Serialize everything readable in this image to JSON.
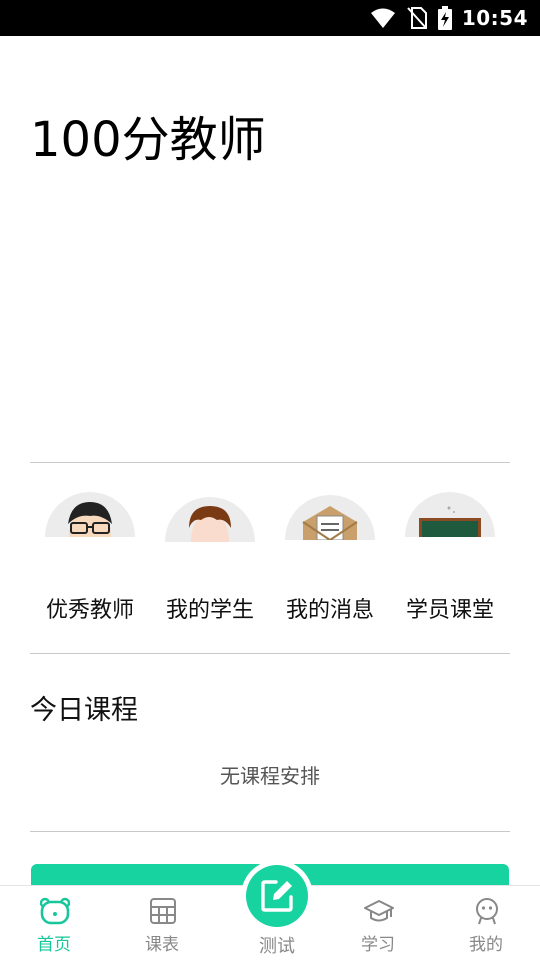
{
  "status_bar": {
    "time": "10:54",
    "icons": [
      "wifi-icon",
      "no-sim-icon",
      "battery-charging-icon"
    ]
  },
  "header": {
    "title": "100分教师"
  },
  "quick_menu": {
    "items": [
      {
        "label": "优秀教师",
        "icon": "teacher-avatar-icon"
      },
      {
        "label": "我的学生",
        "icon": "student-avatar-icon"
      },
      {
        "label": "我的消息",
        "icon": "message-envelope-icon"
      },
      {
        "label": "学员课堂",
        "icon": "classroom-blackboard-icon"
      }
    ]
  },
  "today_courses": {
    "title": "今日课程",
    "empty_text": "无课程安排"
  },
  "tab_bar": {
    "active_color": "#17c69a",
    "inactive_color": "#888888",
    "tabs": [
      {
        "label": "首页",
        "icon": "home-bear-icon",
        "active": true
      },
      {
        "label": "课表",
        "icon": "timetable-grid-icon",
        "active": false
      },
      {
        "label": "测试",
        "icon": "edit-pencil-icon",
        "active": false
      },
      {
        "label": "学习",
        "icon": "graduation-cap-icon",
        "active": false
      },
      {
        "label": "我的",
        "icon": "profile-face-icon",
        "active": false
      }
    ]
  },
  "colors": {
    "accent": "#17d3a0",
    "status_bar": "#000000",
    "divider": "#c8c8c8"
  }
}
